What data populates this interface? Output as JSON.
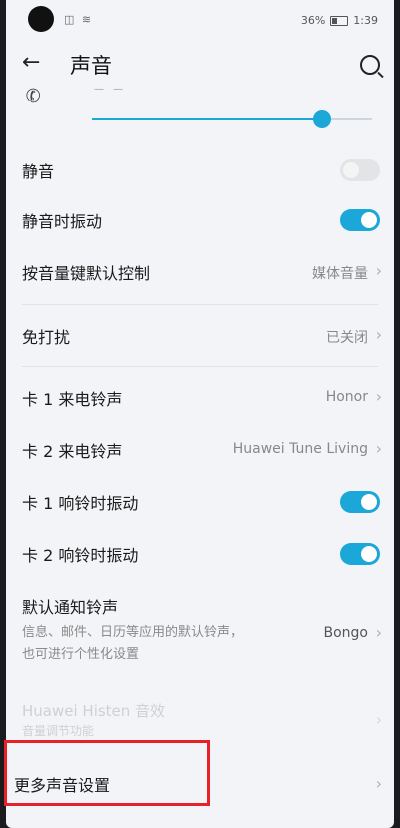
{
  "status_bar": {
    "left": "◫ ≋",
    "battery": "36%",
    "time": "1:39"
  },
  "header": {
    "back_icon": "arrow-left-icon",
    "title": "声音",
    "search_icon": "search-icon"
  },
  "ringtone_volume": {
    "label": "— —",
    "level": 0.82
  },
  "items": {
    "mute": {
      "label": "静音",
      "enabled": false
    },
    "vibrate_silent": {
      "label": "静音时振动",
      "enabled": true
    },
    "volume_key": {
      "label": "按音量键默认控制",
      "value": "媒体音量"
    },
    "dnd": {
      "label": "免打扰",
      "value": "已关闭"
    },
    "sim1_ringtone": {
      "label": "卡 1 来电铃声",
      "value": "Honor"
    },
    "sim2_ringtone": {
      "label": "卡 2 来电铃声",
      "value": "Huawei Tune Living"
    },
    "sim1_vibrate": {
      "label": "卡 1 响铃时振动",
      "enabled": true
    },
    "sim2_vibrate": {
      "label": "卡 2 响铃时振动",
      "enabled": true
    },
    "notif_tone": {
      "label": "默认通知铃声",
      "desc1": "信息、邮件、日历等应用的默认铃声，",
      "desc2": "也可进行个性化设置",
      "value": "Bongo"
    },
    "histen": {
      "label": "Huawei Histen 音效",
      "desc": "音量调节功能"
    },
    "more": {
      "label": "更多声音设置"
    }
  },
  "colors": {
    "accent": "#1ba7d8",
    "highlight": "#e8202a"
  }
}
